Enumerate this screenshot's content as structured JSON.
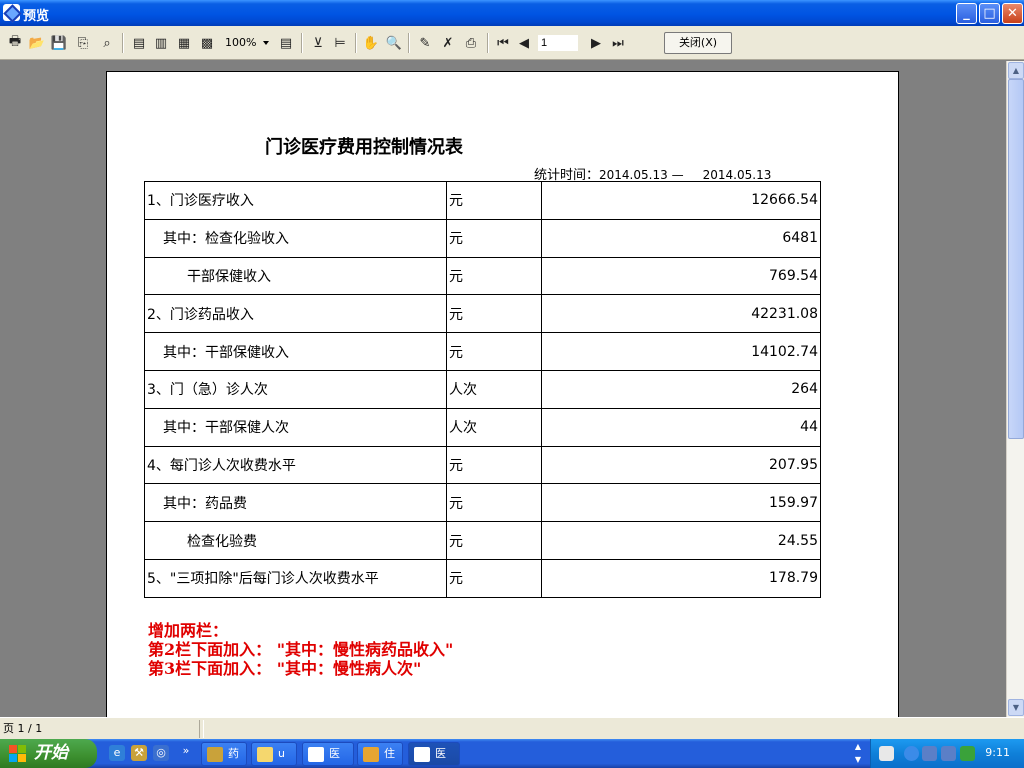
{
  "window": {
    "title": "预览",
    "buttons": {
      "minimize": "_",
      "maximize": "□",
      "close": "✕"
    }
  },
  "toolbar": {
    "zoom": "100%",
    "page_value": "1",
    "close_label": "关闭(X)",
    "icons": [
      "print-icon",
      "open-folder-icon",
      "save-icon",
      "page-setup-icon",
      "find-icon",
      "one-page-icon",
      "two-page-icon",
      "four-page-icon",
      "multi-page-icon",
      "zoom-dropdown",
      "page-width-icon",
      "outline-icon",
      "tree-icon",
      "hand-icon",
      "zoom-in-icon",
      "edit-icon",
      "delete-icon",
      "export-icon",
      "first-page-icon",
      "prev-page-icon",
      "next-page-icon",
      "last-page-icon"
    ]
  },
  "report": {
    "title": "门诊医疗费用控制情况表",
    "stat_label": "统计时间：",
    "stat_from": "2014.05.13",
    "stat_dash": "—",
    "stat_to": "2014.05.13",
    "rows": [
      {
        "item": "1、门诊医疗收入",
        "unit": "元",
        "value": "12666.54",
        "indent": 0
      },
      {
        "item": "其中：检查化验收入",
        "unit": "元",
        "value": "6481",
        "indent": 1
      },
      {
        "item": "干部保健收入",
        "unit": "元",
        "value": "769.54",
        "indent": 2
      },
      {
        "item": "2、门诊药品收入",
        "unit": "元",
        "value": "42231.08",
        "indent": 0
      },
      {
        "item": "其中：干部保健收入",
        "unit": "元",
        "value": "14102.74",
        "indent": 1
      },
      {
        "item": "3、门（急）诊人次",
        "unit": "人次",
        "value": "264",
        "indent": 0
      },
      {
        "item": "其中：干部保健人次",
        "unit": "人次",
        "value": "44",
        "indent": 1
      },
      {
        "item": "4、每门诊人次收费水平",
        "unit": "元",
        "value": "207.95",
        "indent": 0
      },
      {
        "item": "其中：药品费",
        "unit": "元",
        "value": "159.97",
        "indent": 1
      },
      {
        "item": "检查化验费",
        "unit": "元",
        "value": "24.55",
        "indent": 2
      },
      {
        "item": "5、\"三项扣除\"后每门诊人次收费水平",
        "unit": "元",
        "value": "178.79",
        "indent": 0
      }
    ],
    "notes": [
      "增加两栏：",
      "第2栏下面加入：  \"其中：慢性病药品收入\"",
      "第3栏下面加入：  \"其中：慢性病人次\""
    ]
  },
  "statusbar": {
    "page_info": "页 1 / 1"
  },
  "taskbar": {
    "start_label": "开始",
    "tasks": [
      {
        "label": "药",
        "icon": "wrench-icon",
        "active": false
      },
      {
        "label": "u",
        "icon": "folder-icon",
        "active": false
      },
      {
        "label": "医",
        "icon": "app-icon",
        "active": false
      },
      {
        "label": "住",
        "icon": "package-icon",
        "active": false
      },
      {
        "label": "医",
        "icon": "app-icon",
        "active": true
      }
    ],
    "clock": "9:11"
  }
}
